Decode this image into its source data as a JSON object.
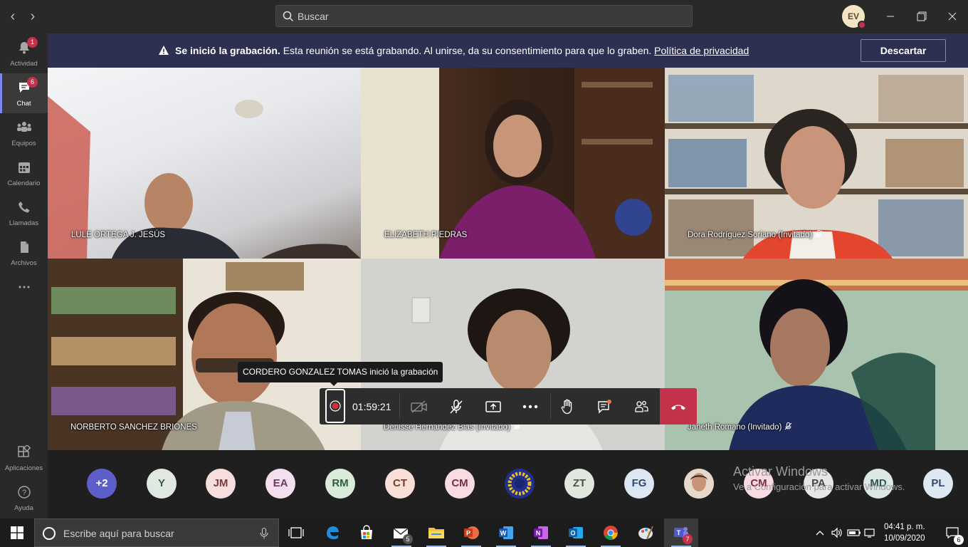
{
  "search": {
    "placeholder": "Buscar"
  },
  "user": {
    "initials": "EV"
  },
  "rail": [
    {
      "label": "Actividad",
      "badge": "1"
    },
    {
      "label": "Chat",
      "badge": "6"
    },
    {
      "label": "Equipos"
    },
    {
      "label": "Calendario"
    },
    {
      "label": "Llamadas"
    },
    {
      "label": "Archivos"
    },
    {
      "label": "Aplicaciones"
    },
    {
      "label": "Ayuda"
    }
  ],
  "banner": {
    "title": "Se inició la grabación.",
    "text": " Esta reunión se está grabando. Al unirse, da su consentimiento para que lo graben. ",
    "link": "Política de privacidad",
    "dismiss": "Descartar"
  },
  "participants": [
    {
      "name": "LULE ORTEGA J. JESÚS",
      "muted": false
    },
    {
      "name": "ELIZABETH PIEDRAS",
      "muted": false
    },
    {
      "name": "Dora Rodríguez Soriano (Invitado)",
      "muted": true
    },
    {
      "name": "NORBERTO SANCHEZ BRIONES",
      "muted": false
    },
    {
      "name": "Denisse Hernández Blas (Invitado)",
      "muted": true
    },
    {
      "name": "Janeth Romano (Invitado)",
      "muted": true
    }
  ],
  "tooltip": "CORDERO GONZALEZ TOMAS inició la grabación",
  "call": {
    "timer": "01:59:21"
  },
  "strip": [
    {
      "initials": "+2",
      "bg": "#5b5fc7",
      "fg": "#ffffff"
    },
    {
      "initials": "Y",
      "bg": "#dfe9e2",
      "fg": "#3d5a48"
    },
    {
      "initials": "JM",
      "bg": "#f6dede",
      "fg": "#7a3b3b"
    },
    {
      "initials": "EA",
      "bg": "#f4dfee",
      "fg": "#6b3a62"
    },
    {
      "initials": "RM",
      "bg": "#d9ecdc",
      "fg": "#2f5d38"
    },
    {
      "initials": "CT",
      "bg": "#f8e0d8",
      "fg": "#7a3b27"
    },
    {
      "initials": "CM",
      "bg": "#f9dbe2",
      "fg": "#7b2c40"
    },
    {
      "initials": "",
      "bg": "#20308c",
      "fg": "#f0c020"
    },
    {
      "initials": "ZT",
      "bg": "#e1e6df",
      "fg": "#4a5546"
    },
    {
      "initials": "FG",
      "bg": "#dde7f3",
      "fg": "#2f4a72"
    },
    {
      "initials": "",
      "bg": "#d9a888",
      "fg": "#ffffff"
    },
    {
      "initials": "CM",
      "bg": "#f9dbe2",
      "fg": "#7b2c40"
    },
    {
      "initials": "PA",
      "bg": "#e6e6e6",
      "fg": "#444444"
    },
    {
      "initials": "MD",
      "bg": "#dce8e6",
      "fg": "#30534d"
    },
    {
      "initials": "PL",
      "bg": "#dde8f2",
      "fg": "#2d4c6c"
    }
  ],
  "watermark": {
    "line1": "Activar Windows",
    "line2": "Ve a Configuración para activar Windows."
  },
  "taskbar": {
    "search_placeholder": "Escribe aquí para buscar",
    "mail_count": "5",
    "teams_count": "7",
    "notif_count": "6",
    "time": "04:41 p. m.",
    "date": "10/09/2020"
  }
}
